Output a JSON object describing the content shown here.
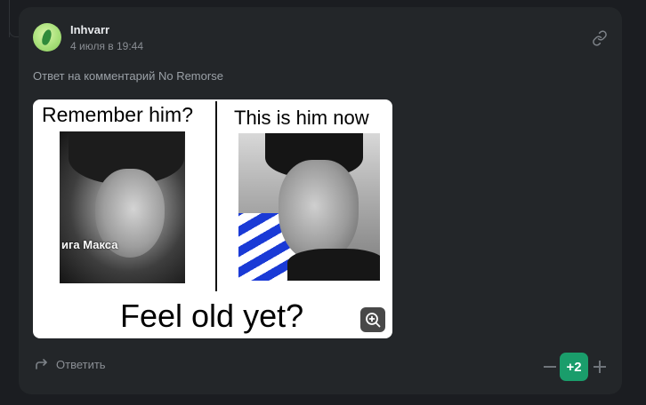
{
  "comment": {
    "author": "Inhvarr",
    "date": "4 июля в 19:44",
    "reply_to": "Ответ на комментарий No Remorse",
    "meme": {
      "caption_left": "Remember him?",
      "caption_right": "This is him now",
      "caption_bottom": "Feel old yet?",
      "overlay_text": "ига Макса"
    },
    "actions": {
      "reply_label": "Ответить",
      "score": "+2"
    },
    "icons": {
      "link": "link-icon",
      "zoom": "zoom-in-icon",
      "reply": "reply-arrow-icon",
      "minus": "minus-icon",
      "plus": "plus-icon"
    },
    "colors": {
      "score_bg": "#1a9d6b",
      "card_bg": "#232629",
      "page_bg": "#1b1d21"
    }
  }
}
